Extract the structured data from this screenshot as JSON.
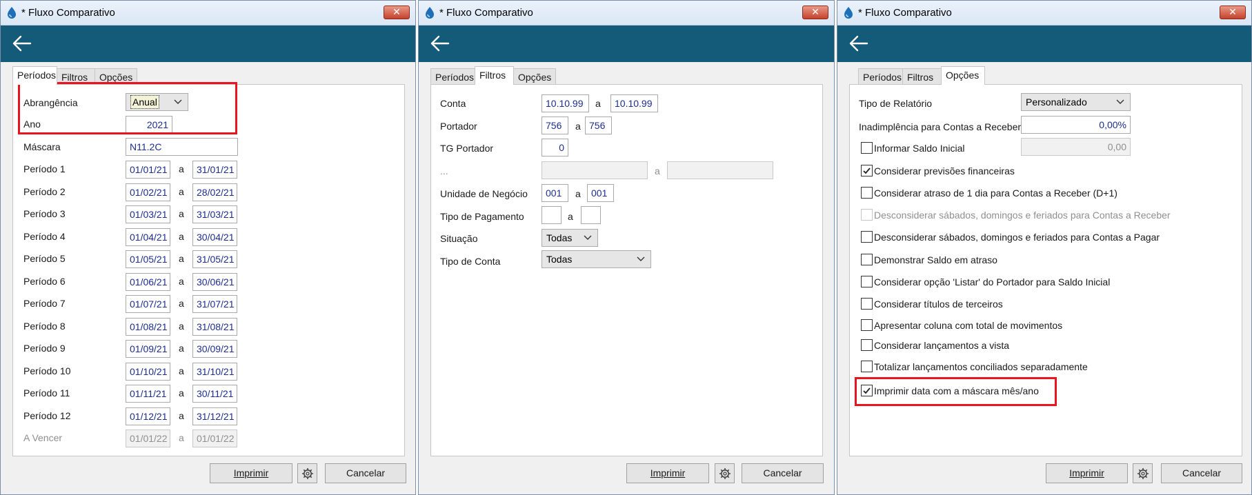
{
  "window_title": "* Fluxo Comparativo",
  "close_label": "✕",
  "tabs": [
    "Períodos",
    "Filtros",
    "Opções"
  ],
  "buttons": {
    "print": "Imprimir",
    "cancel": "Cancelar"
  },
  "colors": {
    "header": "#145a79",
    "highlight": "#e8141e",
    "value_text": "#1c2d8f"
  },
  "icons": [
    "app-drop-icon",
    "back-arrow-icon",
    "chevron-down-icon",
    "gear-icon",
    "checkmark-icon"
  ],
  "periodos": {
    "abrangencia": {
      "label": "Abrangência",
      "value": "Anual"
    },
    "ano": {
      "label": "Ano",
      "value": "2021"
    },
    "mascara": {
      "label": "Máscara",
      "value": "N11.2C"
    },
    "sep": "a",
    "periods": [
      {
        "label": "Período 1",
        "from": "01/01/21",
        "to": "31/01/21"
      },
      {
        "label": "Período 2",
        "from": "01/02/21",
        "to": "28/02/21"
      },
      {
        "label": "Período 3",
        "from": "01/03/21",
        "to": "31/03/21"
      },
      {
        "label": "Período 4",
        "from": "01/04/21",
        "to": "30/04/21"
      },
      {
        "label": "Período 5",
        "from": "01/05/21",
        "to": "31/05/21"
      },
      {
        "label": "Período 6",
        "from": "01/06/21",
        "to": "30/06/21"
      },
      {
        "label": "Período 7",
        "from": "01/07/21",
        "to": "31/07/21"
      },
      {
        "label": "Período 8",
        "from": "01/08/21",
        "to": "31/08/21"
      },
      {
        "label": "Período 9",
        "from": "01/09/21",
        "to": "30/09/21"
      },
      {
        "label": "Período 10",
        "from": "01/10/21",
        "to": "31/10/21"
      },
      {
        "label": "Período 11",
        "from": "01/11/21",
        "to": "30/11/21"
      },
      {
        "label": "Período 12",
        "from": "01/12/21",
        "to": "31/12/21"
      }
    ],
    "a_vencer": {
      "label": "A Vencer",
      "from": "01/01/22",
      "to": "01/01/22"
    }
  },
  "filtros": {
    "sep": "a",
    "conta": {
      "label": "Conta",
      "from": "10.10.99",
      "to": "10.10.99"
    },
    "portador": {
      "label": "Portador",
      "from": "756",
      "to": "756"
    },
    "tg_portador": {
      "label": "TG Portador",
      "value": "0"
    },
    "ellipsis": {
      "label": "...",
      "from": "",
      "to": ""
    },
    "unidade": {
      "label": "Unidade de Negócio",
      "from": "001",
      "to": "001"
    },
    "tipo_pagamento": {
      "label": "Tipo de Pagamento",
      "from": "",
      "to": ""
    },
    "situacao": {
      "label": "Situação",
      "value": "Todas"
    },
    "tipo_conta": {
      "label": "Tipo de Conta",
      "value": "Todas"
    }
  },
  "opcoes": {
    "tipo_relatorio": {
      "label": "Tipo de Relatório",
      "value": "Personalizado"
    },
    "inadimplencia": {
      "label": "Inadimplência para Contas a Receber",
      "value": "0,00%"
    },
    "saldo_inicial": {
      "label": "Informar Saldo Inicial",
      "value": "0,00",
      "checked": false
    },
    "options": [
      {
        "label": "Considerar previsões financeiras",
        "checked": true,
        "enabled": true
      },
      {
        "label": "Considerar atraso de 1 dia para Contas a Receber (D+1)",
        "checked": false,
        "enabled": true
      },
      {
        "label": "Desconsiderar sábados, domingos e feriados para Contas a Receber",
        "checked": false,
        "enabled": false
      },
      {
        "label": "Desconsiderar sábados, domingos e feriados para Contas a Pagar",
        "checked": false,
        "enabled": true
      },
      {
        "label": "Demonstrar Saldo em atraso",
        "checked": false,
        "enabled": true
      },
      {
        "label": "Considerar opção 'Listar' do Portador para Saldo Inicial",
        "checked": false,
        "enabled": true
      },
      {
        "label": "Considerar títulos de terceiros",
        "checked": false,
        "enabled": true
      },
      {
        "label": "Apresentar coluna com total de movimentos",
        "checked": false,
        "enabled": true
      },
      {
        "label": "Considerar lançamentos a vista",
        "checked": false,
        "enabled": true
      },
      {
        "label": "Totalizar lançamentos conciliados separadamente",
        "checked": false,
        "enabled": true
      },
      {
        "label": "Imprimir data com a máscara mês/ano",
        "checked": true,
        "enabled": true
      }
    ]
  }
}
